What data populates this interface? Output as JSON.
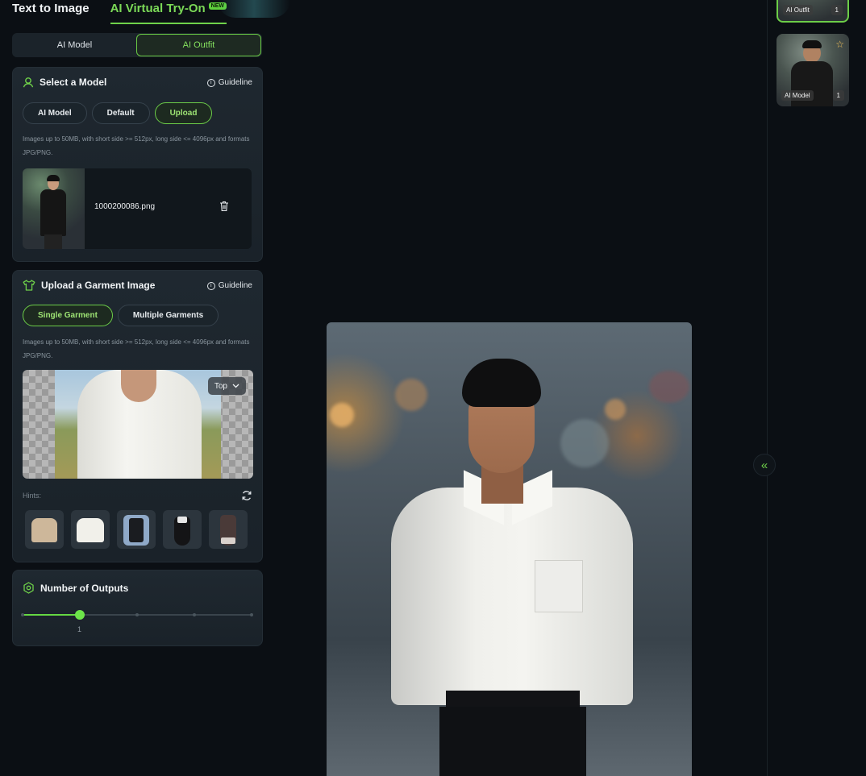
{
  "header": {
    "tabs": [
      {
        "label": "Text to Image",
        "active": false
      },
      {
        "label": "AI Virtual Try-On",
        "active": true,
        "badge": "NEW"
      }
    ]
  },
  "mode_switch": {
    "options": [
      "AI Model",
      "AI Outfit"
    ],
    "selected": "AI Outfit"
  },
  "select_model": {
    "title": "Select a Model",
    "guideline": "Guideline",
    "sources": [
      "AI Model",
      "Default",
      "Upload"
    ],
    "selected_source": "Upload",
    "hint": "Images up to 50MB, with short side >= 512px, long side <= 4096px and formats JPG/PNG.",
    "file_name": "1000200086.png"
  },
  "garment": {
    "title": "Upload a Garment Image",
    "guideline": "Guideline",
    "modes": [
      "Single Garment",
      "Multiple Garments"
    ],
    "selected_mode": "Single Garment",
    "hint": "Images up to 50MB, with short side >= 512px, long side <= 4096px and formats JPG/PNG.",
    "garment_type": "Top",
    "hints_label": "Hints:",
    "hint_items": [
      "beige-shirt",
      "white-tshirt",
      "denim-vest-outfit",
      "black-dress",
      "brown-dress"
    ]
  },
  "outputs": {
    "title": "Number of Outputs",
    "value": "1",
    "fraction": 0.25,
    "ticks": [
      0,
      0.25,
      0.5,
      0.75,
      1
    ]
  },
  "history": [
    {
      "label": "AI Outfit",
      "count": "1",
      "active": true
    },
    {
      "label": "AI Model",
      "count": "1",
      "active": false
    }
  ],
  "colors": {
    "accent": "#6fd14a",
    "panel": "#1f2830",
    "background": "#0b0f14"
  }
}
